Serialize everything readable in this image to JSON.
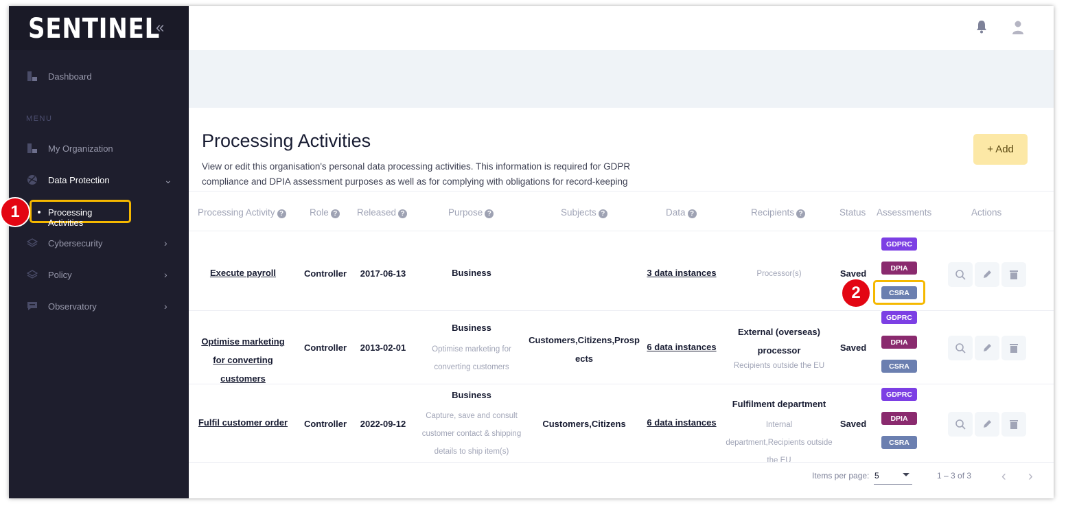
{
  "brand": {
    "logo_text": "SENTINEL"
  },
  "sidebar": {
    "collapse_icon": "double-chevron-left-icon",
    "dashboard": "Dashboard",
    "menu_heading": "MENU",
    "items": [
      {
        "label": "My Organization",
        "icon": "org-icon"
      },
      {
        "label": "Data Protection",
        "icon": "globe-icon"
      },
      {
        "label": "Processing Activities"
      },
      {
        "label": "Cybersecurity",
        "icon": "layers-icon"
      },
      {
        "label": "Policy",
        "icon": "layers-icon"
      },
      {
        "label": "Observatory",
        "icon": "message-icon"
      }
    ]
  },
  "annotations": {
    "one": "1",
    "two": "2"
  },
  "header": {
    "bell_icon": "bell-icon",
    "user_icon": "user-icon"
  },
  "page": {
    "title": "Processing Activities",
    "description": "View or edit this organisation's personal data processing activities. This information is required for GDPR compliance and DPIA assessment purposes as well as for complying with obligations for record-keeping",
    "add_label": "+ Add"
  },
  "table": {
    "headers": {
      "activity": "Processing Activity",
      "role": "Role",
      "released": "Released",
      "purpose": "Purpose",
      "subjects": "Subjects",
      "data": "Data",
      "recipients": "Recipients",
      "status": "Status",
      "assessments": "Assessments",
      "actions": "Actions"
    },
    "rows": [
      {
        "activity": "Execute payroll",
        "role": "Controller",
        "released": "2017-06-13",
        "purpose_title": "Business",
        "purpose_desc": "",
        "subjects": "",
        "data": "3 data instances",
        "recipients_title": "",
        "recipients_desc": "Processor(s)",
        "status": "Saved",
        "tags": [
          "GDPRC",
          "DPIA",
          "CSRA"
        ]
      },
      {
        "activity": "Optimise marketing for converting customers",
        "role": "Controller",
        "released": "2013-02-01",
        "purpose_title": "Business",
        "purpose_desc": "Optimise marketing for converting customers",
        "subjects": "Customers,Citizens,Prospects",
        "data": "6 data instances",
        "recipients_title": "External (overseas) processor",
        "recipients_desc": "Recipients outside the EU",
        "status": "Saved",
        "tags": [
          "GDPRC",
          "DPIA",
          "CSRA"
        ]
      },
      {
        "activity": "Fulfil customer order",
        "role": "Controller",
        "released": "2022-09-12",
        "purpose_title": "Business",
        "purpose_desc": "Capture, save and consult customer contact & shipping details to ship item(s)",
        "subjects": "Customers,Citizens",
        "data": "6 data instances",
        "recipients_title": "Fulfilment department",
        "recipients_desc": "Internal department,Recipients outside the EU",
        "status": "Saved",
        "tags": [
          "GDPRC",
          "DPIA",
          "CSRA"
        ]
      }
    ]
  },
  "pagination": {
    "items_per_page_label": "Items per page:",
    "items_per_page_value": "5",
    "range": "1 – 3 of 3"
  },
  "colors": {
    "sidebar": "#1e1e2d",
    "highlight": "#f5b800",
    "badge": "#e30613",
    "gdprc": "#7c3fe4",
    "dpia": "#8a2a6e",
    "csra": "#6b7fb0"
  }
}
